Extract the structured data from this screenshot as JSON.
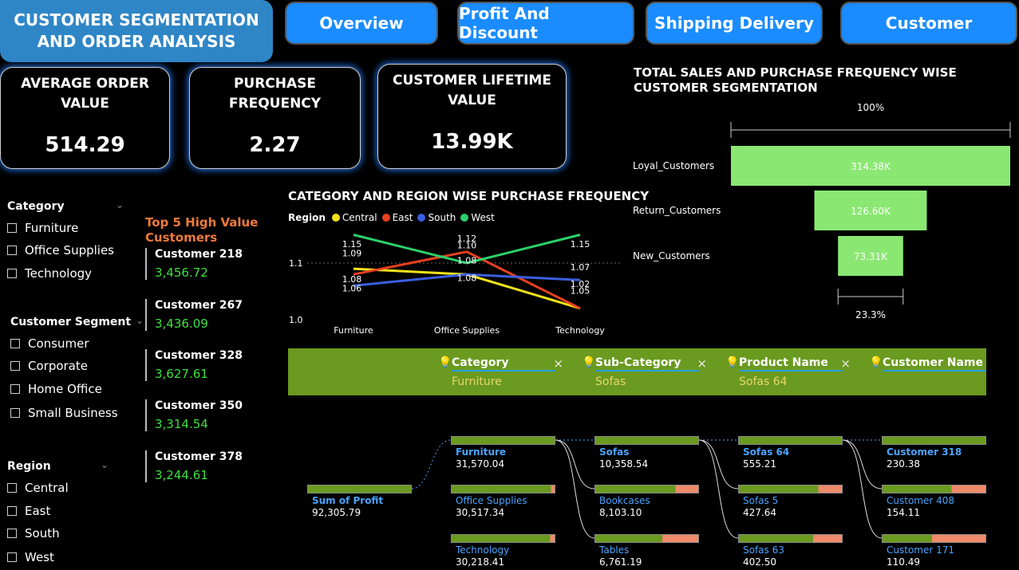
{
  "header": {
    "title_line1": "CUSTOMER SEGMENTATION",
    "title_line2": "AND ORDER ANALYSIS",
    "nav": [
      "Overview",
      "Profit And Discount",
      "Shipping Delivery",
      "Customer"
    ]
  },
  "kpis": [
    {
      "label_line1": "AVERAGE ORDER",
      "label_line2": "VALUE",
      "value": "514.29"
    },
    {
      "label_line1": "PURCHASE",
      "label_line2": "FREQUENCY",
      "value": "2.27"
    },
    {
      "label_line1": "CUSTOMER LIFETIME",
      "label_line2": "VALUE",
      "value": "13.99K"
    }
  ],
  "slicers": {
    "category": {
      "title": "Category",
      "items": [
        "Furniture",
        "Office Supplies",
        "Technology"
      ]
    },
    "segment": {
      "title": "Customer Segment",
      "items": [
        "Consumer",
        "Corporate",
        "Home Office",
        "Small Business"
      ]
    },
    "region": {
      "title": "Region",
      "items": [
        "Central",
        "East",
        "South",
        "West"
      ]
    }
  },
  "top_customers": {
    "title_line1": "Top 5 High Value",
    "title_line2": "Customers",
    "items": [
      {
        "name": "Customer 218",
        "value": "3,456.72"
      },
      {
        "name": "Customer 267",
        "value": "3,436.09"
      },
      {
        "name": "Customer 328",
        "value": "3,627.61"
      },
      {
        "name": "Customer 350",
        "value": "3,314.54"
      },
      {
        "name": "Customer 378",
        "value": "3,244.61"
      }
    ]
  },
  "chart_data": [
    {
      "type": "line",
      "title": "CATEGORY AND REGION WISE PURCHASE FREQUENCY",
      "legend_title": "Region",
      "legend_position": "top-left",
      "categories": [
        "Furniture",
        "Office Supplies",
        "Technology"
      ],
      "ylim": [
        1.0,
        1.15
      ],
      "yticks": [
        "1.0",
        "1.1"
      ],
      "series": [
        {
          "name": "Central",
          "color": "#f2e21a",
          "values": [
            1.09,
            1.08,
            1.02
          ]
        },
        {
          "name": "East",
          "color": "#e8401f",
          "values": [
            1.08,
            1.12,
            1.02
          ]
        },
        {
          "name": "South",
          "color": "#3b5fe0",
          "values": [
            1.06,
            1.08,
            1.07
          ]
        },
        {
          "name": "West",
          "color": "#2bd16a",
          "values": [
            1.15,
            1.1,
            1.15
          ]
        }
      ],
      "labels": [
        {
          "cat": 0,
          "text": "1.15",
          "v": 1.128
        },
        {
          "cat": 0,
          "text": "1.09",
          "v": 1.112
        },
        {
          "cat": 0,
          "text": "1.08",
          "v": 1.066
        },
        {
          "cat": 0,
          "text": "1.06",
          "v": 1.05
        },
        {
          "cat": 1,
          "text": "1.12",
          "v": 1.138
        },
        {
          "cat": 1,
          "text": "1.10",
          "v": 1.126
        },
        {
          "cat": 1,
          "text": "1.08",
          "v": 1.099
        },
        {
          "cat": 1,
          "text": "1.08",
          "v": 1.068
        },
        {
          "cat": 2,
          "text": "1.15",
          "v": 1.128
        },
        {
          "cat": 2,
          "text": "1.07",
          "v": 1.087
        },
        {
          "cat": 2,
          "text": "1.02",
          "v": 1.058
        },
        {
          "cat": 2,
          "text": "1.05",
          "v": 1.046
        }
      ]
    },
    {
      "type": "funnel",
      "title": "TOTAL SALES AND PURCHASE FREQUENCY WISE CUSTOMER SEGMENTATION",
      "top_label": "100%",
      "bottom_label": "23.3%",
      "color": "#8ae872",
      "categories": [
        "Loyal_Customers",
        "Return_Customers",
        "New_Customers"
      ],
      "values": [
        314380,
        126600,
        73310
      ],
      "value_labels": [
        "314.38K",
        "126.60K",
        "73.31K"
      ]
    }
  ],
  "filters": [
    {
      "header": "Category",
      "value": "Furniture"
    },
    {
      "header": "Sub-Category",
      "value": "Sofas"
    },
    {
      "header": "Product Name",
      "value": "Sofas 64"
    },
    {
      "header": "Customer Name",
      "value": ""
    }
  ],
  "decomp": {
    "root": {
      "label": "Sum of Profit",
      "value": "92,305.79"
    },
    "levels": [
      [
        {
          "label": "Furniture",
          "value": "31,570.04",
          "fill": 1.0,
          "selected": true
        },
        {
          "label": "Office Supplies",
          "value": "30,517.34",
          "fill": 0.967
        },
        {
          "label": "Technology",
          "value": "30,218.41",
          "fill": 0.957
        }
      ],
      [
        {
          "label": "Sofas",
          "value": "10,358.54",
          "fill": 1.0,
          "selected": true
        },
        {
          "label": "Bookcases",
          "value": "8,103.10",
          "fill": 0.78
        },
        {
          "label": "Tables",
          "value": "6,761.19",
          "fill": 0.65
        }
      ],
      [
        {
          "label": "Sofas 64",
          "value": "555.21",
          "fill": 1.0,
          "selected": true
        },
        {
          "label": "Sofas 5",
          "value": "427.64",
          "fill": 0.77
        },
        {
          "label": "Sofas 63",
          "value": "402.50",
          "fill": 0.72
        }
      ],
      [
        {
          "label": "Customer 318",
          "value": "230.38",
          "fill": 1.0,
          "selected": true
        },
        {
          "label": "Customer 408",
          "value": "154.11",
          "fill": 0.67
        },
        {
          "label": "Customer 171",
          "value": "110.49",
          "fill": 0.48
        }
      ]
    ]
  }
}
